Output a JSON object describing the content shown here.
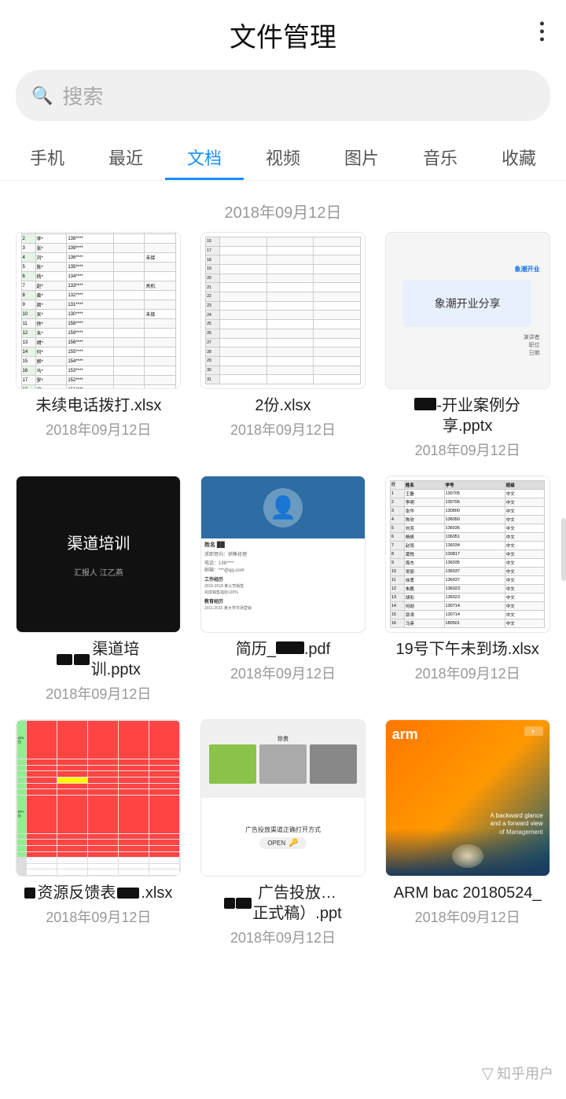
{
  "header": {
    "title": "文件管理",
    "menu_icon": "⋮"
  },
  "search": {
    "placeholder": "搜索"
  },
  "nav": {
    "tabs": [
      {
        "id": "phone",
        "label": "手机",
        "active": false
      },
      {
        "id": "recent",
        "label": "最近",
        "active": false
      },
      {
        "id": "docs",
        "label": "文档",
        "active": true
      },
      {
        "id": "video",
        "label": "视频",
        "active": false
      },
      {
        "id": "images",
        "label": "图片",
        "active": false
      },
      {
        "id": "music",
        "label": "音乐",
        "active": false
      },
      {
        "id": "favorites",
        "label": "收藏",
        "active": false
      }
    ]
  },
  "sections": [
    {
      "date": "2018年09月12日",
      "files": [
        {
          "name": "未续电话拨打.xlsx",
          "date": "2018年09月12日",
          "type": "xlsx-green"
        },
        {
          "name": "2份.xlsx",
          "date": "2018年09月12日",
          "type": "xlsx-plain"
        },
        {
          "name": "-开业案例分享.pptx",
          "date": "2018年09月12日",
          "type": "pptx-open"
        }
      ]
    },
    {
      "date": "",
      "files": [
        {
          "name": "渠道培训.pptx",
          "date": "2018年09月12日",
          "type": "pptx-dark"
        },
        {
          "name": "简历_.pdf",
          "date": "2018年09月12日",
          "type": "pdf"
        },
        {
          "name": "19号下午未到场.xlsx",
          "date": "2018年09月12日",
          "type": "xlsx-list"
        }
      ]
    },
    {
      "date": "",
      "files": [
        {
          "name": "资源反馈表.xlsx",
          "date": "2018年09月12日",
          "type": "xlsx-red"
        },
        {
          "name": "广告投放正式稿）.ppt",
          "date": "2018年09月12日",
          "type": "ppt-ad"
        },
        {
          "name": "ARM bac 20180524_",
          "date": "2018年09月12日",
          "type": "arm"
        }
      ]
    }
  ],
  "watermark": {
    "text": "知乎用户",
    "icon": "▽"
  }
}
